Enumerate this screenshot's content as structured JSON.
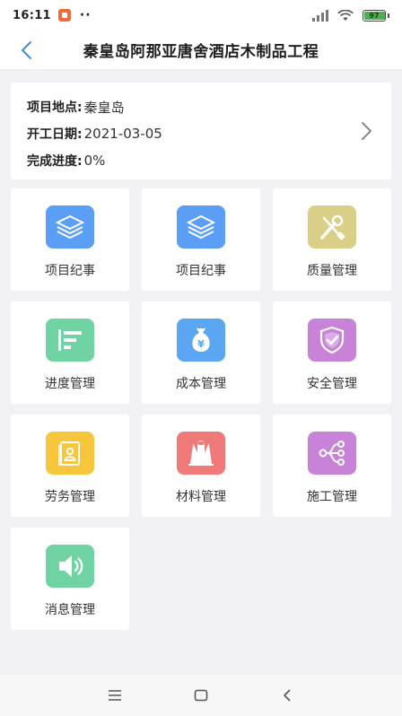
{
  "status_bar": {
    "time": "16:11",
    "dots": "··",
    "battery_level": "97",
    "battery_fraction": 0.97,
    "battery_color": "#4caf50",
    "notification_color": "#f06b3a"
  },
  "header": {
    "title": "秦皇岛阿那亚唐舍酒店木制品工程",
    "back_color": "#3a8ee6"
  },
  "info": {
    "location_label": "项目地点:",
    "location_value": "秦皇岛",
    "start_date_label": "开工日期:",
    "start_date_value": "2021-03-05",
    "progress_label": "完成进度:",
    "progress_value": "0%"
  },
  "tiles": [
    {
      "label": "项目纪事",
      "icon": "layers-icon",
      "color": "#5b9ef5"
    },
    {
      "label": "项目纪事",
      "icon": "layers-icon",
      "color": "#5b9ef5"
    },
    {
      "label": "质量管理",
      "icon": "tools-icon",
      "color": "#d9cf86"
    },
    {
      "label": "进度管理",
      "icon": "progress-bars-icon",
      "color": "#6fd3a3"
    },
    {
      "label": "成本管理",
      "icon": "money-bag-icon",
      "color": "#5aa6f0"
    },
    {
      "label": "安全管理",
      "icon": "shield-check-icon",
      "color": "#c882d8"
    },
    {
      "label": "劳务管理",
      "icon": "id-card-icon",
      "color": "#f7c63c"
    },
    {
      "label": "材料管理",
      "icon": "materials-icon",
      "color": "#f07a7a"
    },
    {
      "label": "施工管理",
      "icon": "branch-icon",
      "color": "#c882d8"
    },
    {
      "label": "消息管理",
      "icon": "speaker-icon",
      "color": "#6fd3a3"
    }
  ]
}
